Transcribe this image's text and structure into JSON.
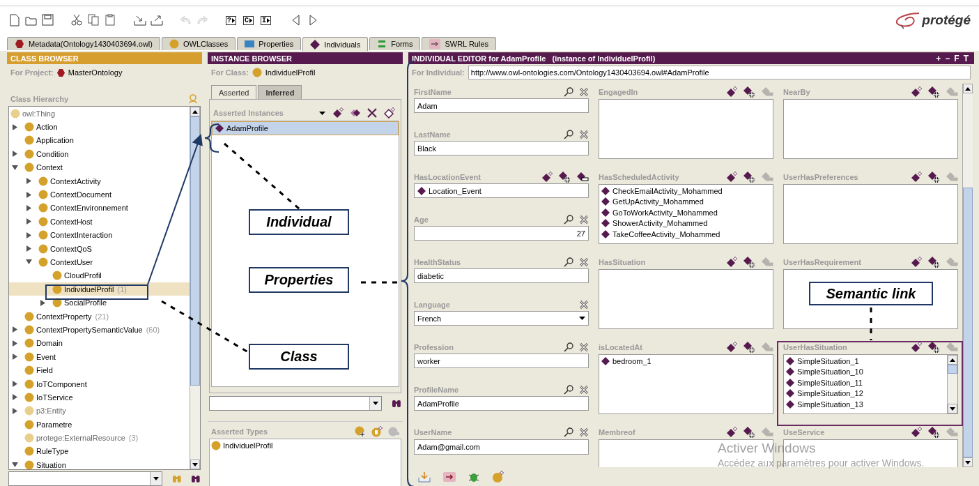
{
  "toolbar": [
    {
      "kind": "new",
      "disabled": false
    },
    {
      "kind": "open",
      "disabled": false
    },
    {
      "kind": "save",
      "disabled": false
    },
    {
      "kind": "cut",
      "disabled": false
    },
    {
      "kind": "copy",
      "disabled": false
    },
    {
      "kind": "paste",
      "disabled": false
    },
    {
      "kind": "import",
      "disabled": false
    },
    {
      "kind": "export",
      "disabled": false
    },
    {
      "kind": "undo",
      "disabled": true
    },
    {
      "kind": "redo",
      "disabled": true
    },
    {
      "kind": "glyph",
      "label": "?",
      "disabled": false
    },
    {
      "kind": "glyph",
      "label": "C",
      "disabled": false
    },
    {
      "kind": "glyph",
      "label": "I",
      "disabled": false
    },
    {
      "kind": "back",
      "disabled": false
    },
    {
      "kind": "forward",
      "disabled": false
    }
  ],
  "logo": {
    "text": "protégé"
  },
  "tabs": [
    {
      "label": "Metadata(Ontology1430403694.owl)",
      "selected": false
    },
    {
      "label": "OWLClasses",
      "selected": false
    },
    {
      "label": "Properties",
      "selected": false
    },
    {
      "label": "Individuals",
      "selected": true
    },
    {
      "label": "Forms",
      "selected": false
    },
    {
      "label": "SWRL Rules",
      "selected": false
    }
  ],
  "class_browser": {
    "title": "CLASS BROWSER",
    "project_label": "For Project:",
    "project": "MasterOntology",
    "hierarchy_label": "Class Hierarchy",
    "tree": [
      {
        "label": "owl:Thing",
        "color": "#e8cf8c",
        "imported": true,
        "selected": false,
        "children": [
          {
            "label": "Action",
            "color": "#d4a12a",
            "imported": false,
            "selected": false,
            "expanded": false
          },
          {
            "label": "Application",
            "color": "#d4a12a",
            "imported": false,
            "selected": false
          },
          {
            "label": "Condition",
            "color": "#d4a12a",
            "imported": false,
            "selected": false,
            "expanded": false
          },
          {
            "label": "Context",
            "color": "#d4a12a",
            "imported": false,
            "selected": false,
            "expanded": true,
            "children": [
              {
                "label": "ContextActivity",
                "color": "#d4a12a",
                "imported": false,
                "selected": false,
                "expanded": false
              },
              {
                "label": "ContextDocument",
                "color": "#d4a12a",
                "imported": false,
                "selected": false,
                "expanded": false
              },
              {
                "label": "ContextEnvironnement",
                "color": "#d4a12a",
                "imported": false,
                "selected": false,
                "expanded": false
              },
              {
                "label": "ContextHost",
                "color": "#d4a12a",
                "imported": false,
                "selected": false,
                "expanded": false
              },
              {
                "label": "ContextInteraction",
                "color": "#d4a12a",
                "imported": false,
                "selected": false,
                "expanded": false
              },
              {
                "label": "ContextQoS",
                "color": "#d4a12a",
                "imported": false,
                "selected": false,
                "expanded": false
              },
              {
                "label": "ContextUser",
                "color": "#d4a12a",
                "imported": false,
                "selected": false,
                "expanded": true,
                "children": [
                  {
                    "label": "CloudProfil",
                    "color": "#d4a12a",
                    "imported": false,
                    "selected": false
                  },
                  {
                    "label": "IndividuelProfil",
                    "count": "(1)",
                    "color": "#d4a12a",
                    "imported": false,
                    "selected": true
                  },
                  {
                    "label": "SocialProfile",
                    "color": "#d4a12a",
                    "imported": false,
                    "selected": false,
                    "expanded": false
                  }
                ]
              }
            ]
          },
          {
            "label": "ContextProperty",
            "count": "(21)",
            "color": "#d4a12a",
            "imported": false,
            "selected": false
          },
          {
            "label": "ContextPropertySemanticValue",
            "count": "(60)",
            "color": "#d4a12a",
            "imported": false,
            "selected": false,
            "expanded": false
          },
          {
            "label": "Domain",
            "color": "#d4a12a",
            "imported": false,
            "selected": false,
            "expanded": false
          },
          {
            "label": "Event",
            "color": "#d4a12a",
            "imported": false,
            "selected": false,
            "expanded": false
          },
          {
            "label": "Field",
            "color": "#d4a12a",
            "imported": false,
            "selected": false
          },
          {
            "label": "IoTComponent",
            "color": "#d4a12a",
            "imported": false,
            "selected": false,
            "expanded": false
          },
          {
            "label": "IoTService",
            "color": "#d4a12a",
            "imported": false,
            "selected": false,
            "expanded": false
          },
          {
            "label": "p3:Entity",
            "color": "#e8cf8c",
            "imported": true,
            "selected": false,
            "expanded": false
          },
          {
            "label": "Parametre",
            "color": "#d4a12a",
            "imported": false,
            "selected": false
          },
          {
            "label": "protege:ExternalResource",
            "count": "(3)",
            "color": "#e8cf8c",
            "imported": true,
            "selected": false
          },
          {
            "label": "RuleType",
            "color": "#d4a12a",
            "imported": false,
            "selected": false
          },
          {
            "label": "Situation",
            "color": "#d4a12a",
            "imported": false,
            "selected": false,
            "expanded": true
          }
        ]
      }
    ]
  },
  "instance_browser": {
    "title": "INSTANCE BROWSER",
    "class_label": "For Class:",
    "class": "IndividuelProfil",
    "tabs": [
      {
        "label": "Asserted",
        "selected": true
      },
      {
        "label": "Inferred",
        "selected": false
      }
    ],
    "instances_label": "Asserted Instances",
    "instances": [
      {
        "label": "AdamProfile",
        "selected": true
      }
    ],
    "types_label": "Asserted Types",
    "types": [
      "IndividuelProfil"
    ]
  },
  "editor": {
    "title": "INDIVIDUAL EDITOR for AdamProfile   (instance of IndividuelProfil)",
    "header_buttons": [
      "+",
      "−",
      "F",
      "T"
    ],
    "individual_label": "For Individual:",
    "individual": "http://www.owl-ontologies.com/Ontology1430403694.owl#AdamProfile",
    "rows": [
      [
        {
          "kind": "fields",
          "fields": [
            {
              "kind": "text",
              "label": "FirstName",
              "value": "Adam"
            },
            {
              "kind": "text",
              "label": "LastName",
              "value": "Black"
            }
          ]
        },
        {
          "kind": "list",
          "label": "EngagedIn",
          "remove_enabled": false
        },
        {
          "kind": "list",
          "label": "NearBy",
          "remove_enabled": false
        }
      ],
      [
        {
          "kind": "fields",
          "fields": [
            {
              "kind": "instance",
              "label": "HasLocationEvent",
              "value": "Location_Event",
              "remove_enabled": true
            },
            {
              "kind": "number",
              "label": "Age",
              "value": "27"
            }
          ]
        },
        {
          "kind": "list",
          "label": "HasScheduledActivity",
          "remove_enabled": false,
          "items": [
            "CheckEmailActivity_Mohammed",
            "GetUpActivity_Mohammed",
            "GoToWorkActivity_Mohammed",
            "ShowerActivity_Mohammed",
            "TakeCoffeeActivity_Mohammed"
          ]
        },
        {
          "kind": "list",
          "label": "UserHasPreferences",
          "remove_enabled": false
        }
      ],
      [
        {
          "kind": "fields",
          "fields": [
            {
              "kind": "text",
              "label": "HealthStatus",
              "value": "diabetic"
            },
            {
              "kind": "select",
              "label": "Language",
              "value": "French"
            }
          ]
        },
        {
          "kind": "list",
          "label": "HasSituation",
          "remove_enabled": false
        },
        {
          "kind": "list",
          "label": "UserHasRequirement",
          "remove_enabled": false
        }
      ],
      [
        {
          "kind": "fields",
          "fields": [
            {
              "kind": "text",
              "label": "Profession",
              "value": "worker"
            },
            {
              "kind": "text",
              "label": "ProfileName",
              "value": "AdamProfile"
            }
          ]
        },
        {
          "kind": "list",
          "label": "isLocatedAt",
          "remove_enabled": false,
          "items": [
            "bedroom_1"
          ]
        },
        {
          "kind": "list",
          "label": "UserHasSituation",
          "remove_enabled": false,
          "scrollable": true,
          "items": [
            "SimpleSituation_1",
            "SimpleSituation_10",
            "SimpleSituation_11",
            "SimpleSituation_12",
            "SimpleSituation_13"
          ]
        }
      ],
      [
        {
          "kind": "fields",
          "fields": [
            {
              "kind": "text",
              "label": "UserName",
              "value": "Adam@gmail.com"
            }
          ]
        },
        {
          "kind": "list",
          "label": "Membreof",
          "remove_enabled": false
        },
        {
          "kind": "list",
          "label": "UseService",
          "remove_enabled": false
        }
      ]
    ]
  },
  "annotations": [
    {
      "label": "Individual"
    },
    {
      "label": "Properties"
    },
    {
      "label": "Class"
    },
    {
      "label": "Semantic link"
    }
  ],
  "os_notice": {
    "title": "Activer Windows",
    "text": "Accédez aux paramètres pour activer Windows."
  }
}
